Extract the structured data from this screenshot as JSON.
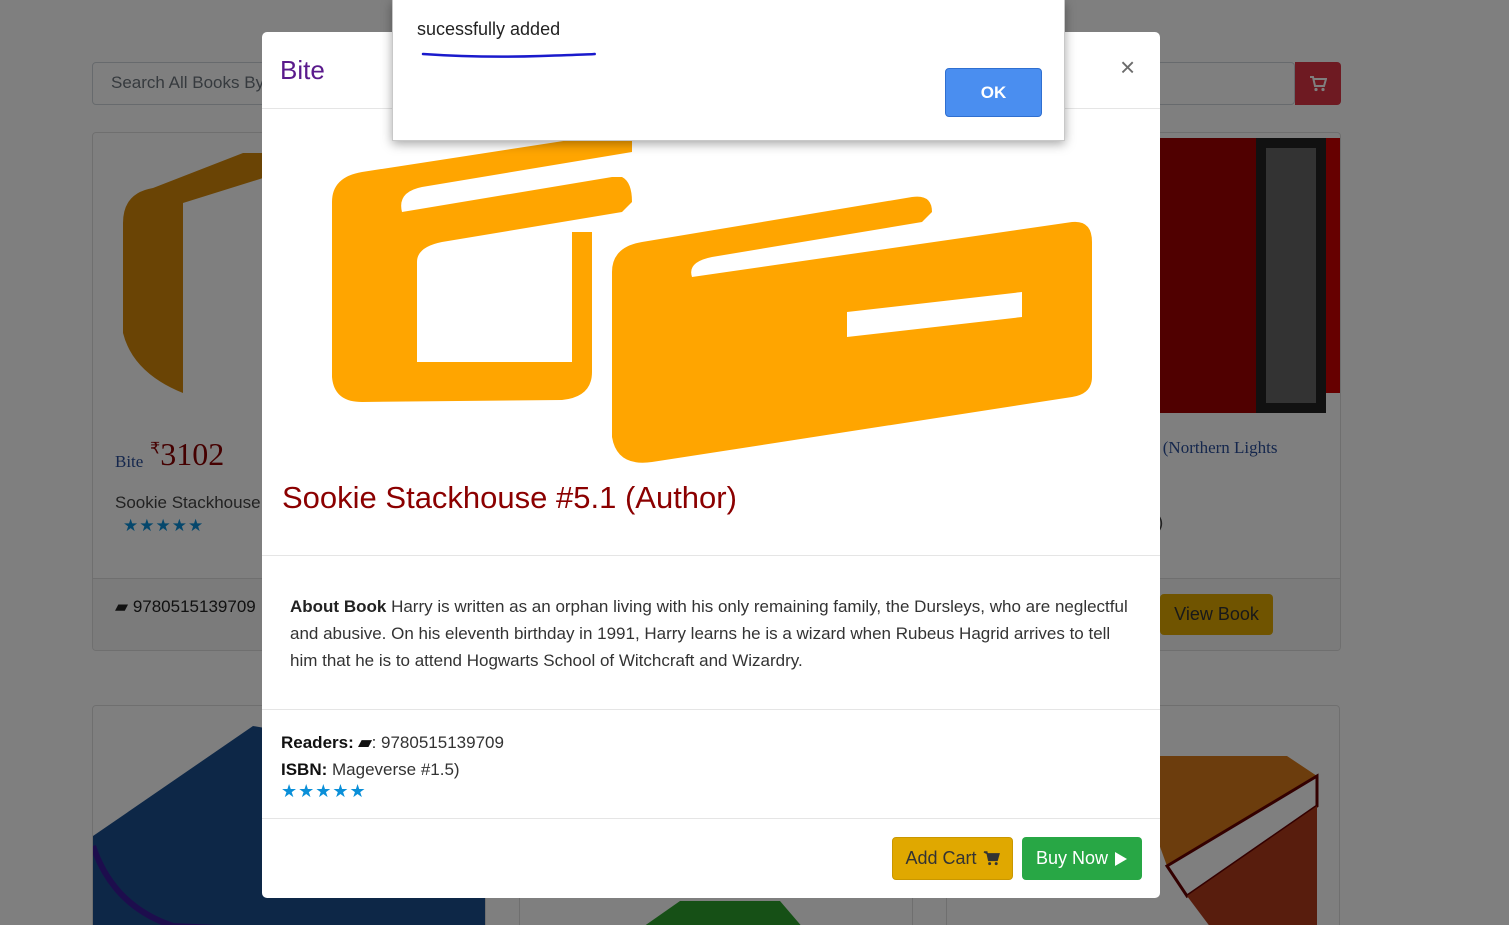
{
  "background": {
    "search_placeholder": "Search All Books By",
    "cards": [
      {
        "brand": "Bite",
        "currency": "₹",
        "price": "3102",
        "title": "Sookie Stackhouse",
        "stars": "★★★★★",
        "isbn": "9780515139709"
      }
    ],
    "right_card_title": "y (Northern Lights",
    "right_card_fragment": "r)",
    "view_book_label": "View Book"
  },
  "modal": {
    "brand": "Bite",
    "close_label": "×",
    "title": "Sookie Stackhouse #5.1 (Author)",
    "about_label": "About Book",
    "about_text": "Harry is written as an orphan living with his only remaining family, the Dursleys, who are neglectful and abusive. On his eleventh birthday in 1991, Harry learns he is a wizard when Rubeus Hagrid arrives to tell him that he is to attend Hogwarts School of Witchcraft and Wizardry.",
    "readers_label": "Readers:",
    "readers_value": ": 9780515139709",
    "isbn_label": "ISBN:",
    "isbn_value": "Mageverse #1.5)",
    "stars": "★★★★★",
    "add_cart_label": "Add Cart",
    "buy_now_label": "Buy Now"
  },
  "alert": {
    "message": "sucessfully added",
    "ok_label": "OK"
  },
  "colors": {
    "brand_purple": "#5a1a8c",
    "title_red": "#8b0000",
    "add_cart": "#e0a800",
    "buy_now": "#28a745",
    "ok_button": "#4a8ef0",
    "cart_button": "#dc3545",
    "logo_orange": "#ffa500"
  }
}
